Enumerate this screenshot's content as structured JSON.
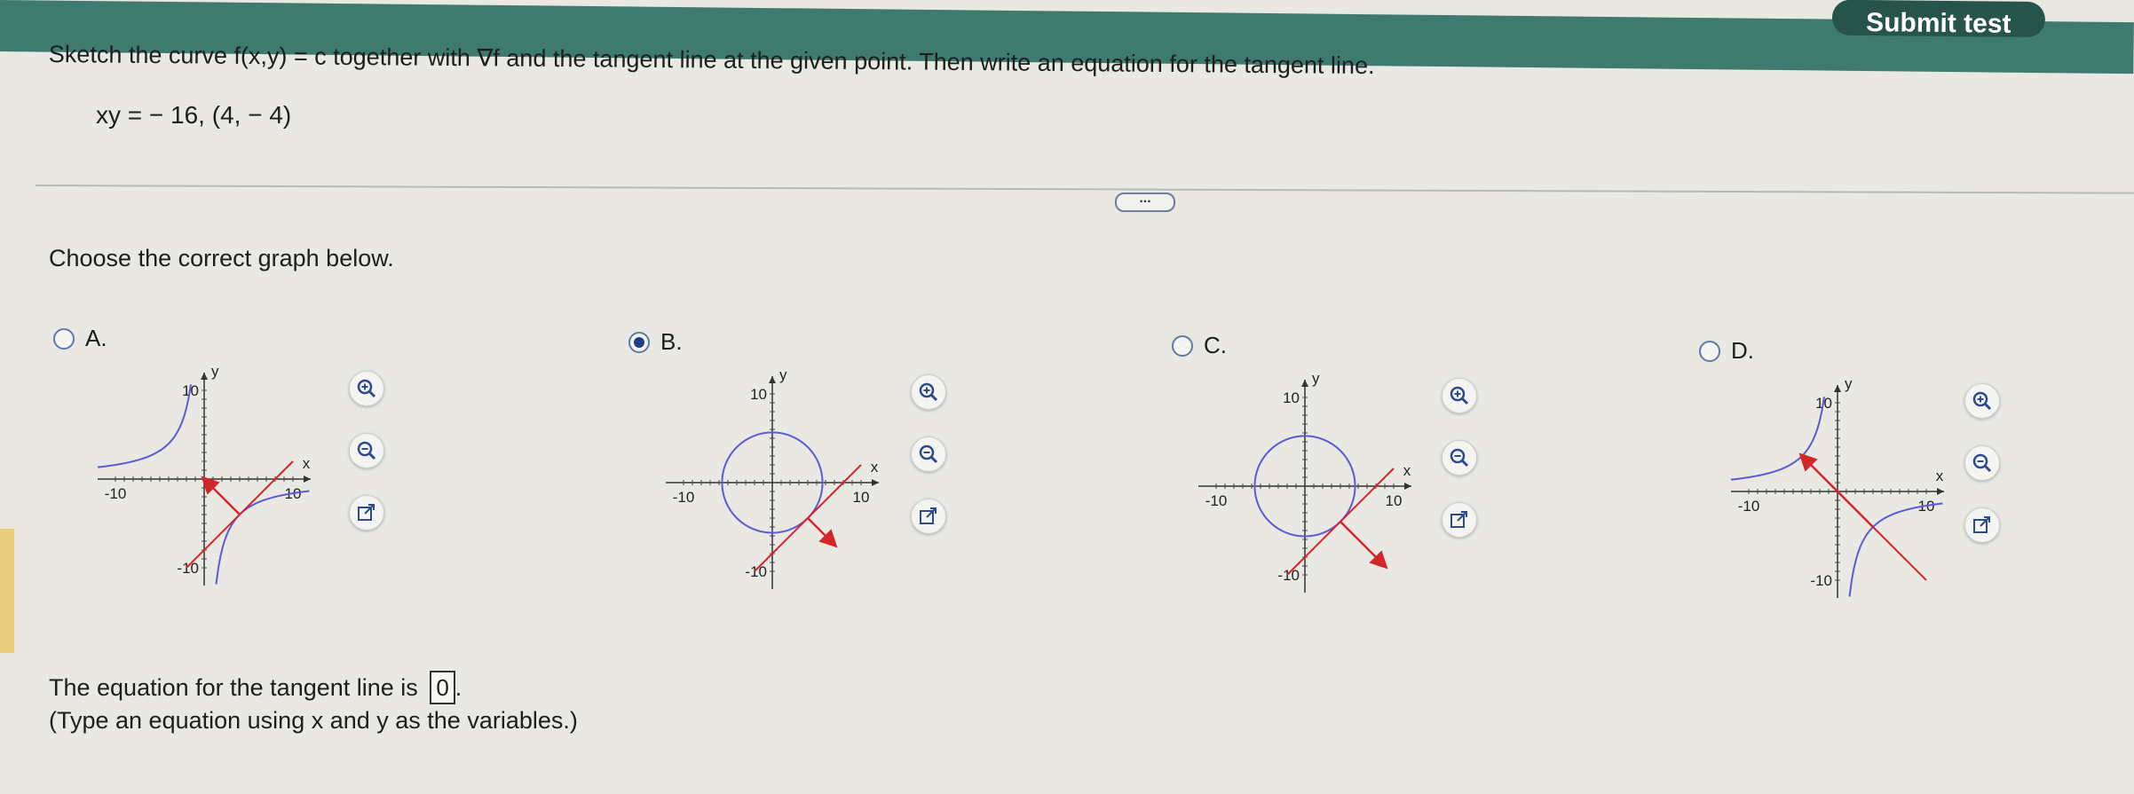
{
  "header": {
    "submit_label": "Submit test"
  },
  "question": {
    "text": "Sketch the curve f(x,y) = c together with ∇f and the tangent line at the given point. Then write an equation for the tangent line.",
    "equation": "xy = − 16,  (4, − 4)",
    "more_label": "..."
  },
  "prompt": "Choose the correct graph below.",
  "options": [
    {
      "letter": "A.",
      "selected": false,
      "axis": {
        "y_label": "y",
        "x_label": "x",
        "ymax_tick": "10",
        "ymin_tick": "-10",
        "xmin_tick": "-10",
        "xmax_tick": "10"
      }
    },
    {
      "letter": "B.",
      "selected": true,
      "axis": {
        "y_label": "y",
        "x_label": "x",
        "ymax_tick": "10",
        "ymin_tick": "-10",
        "xmin_tick": "-10",
        "xmax_tick": "10"
      }
    },
    {
      "letter": "C.",
      "selected": false,
      "axis": {
        "y_label": "y",
        "x_label": "x",
        "ymax_tick": "10",
        "ymin_tick": "-10",
        "xmin_tick": "-10",
        "xmax_tick": "10"
      }
    },
    {
      "letter": "D.",
      "selected": false,
      "axis": {
        "y_label": "y",
        "x_label": "x",
        "ymax_tick": "10",
        "ymin_tick": "-10",
        "xmin_tick": "-10",
        "xmax_tick": "10"
      }
    }
  ],
  "answer": {
    "label": "The equation for the tangent line is",
    "value": "0",
    "suffix": ".",
    "hint": "(Type an equation using x and y as the variables.)"
  },
  "colors": {
    "curve": "#5b5bd6",
    "vector": "#d4252b",
    "radio_selected": "#1d3f86",
    "header": "#3e7a6e"
  },
  "icons": [
    "zoom-in-icon",
    "zoom-out-icon",
    "open-new-window-icon"
  ]
}
